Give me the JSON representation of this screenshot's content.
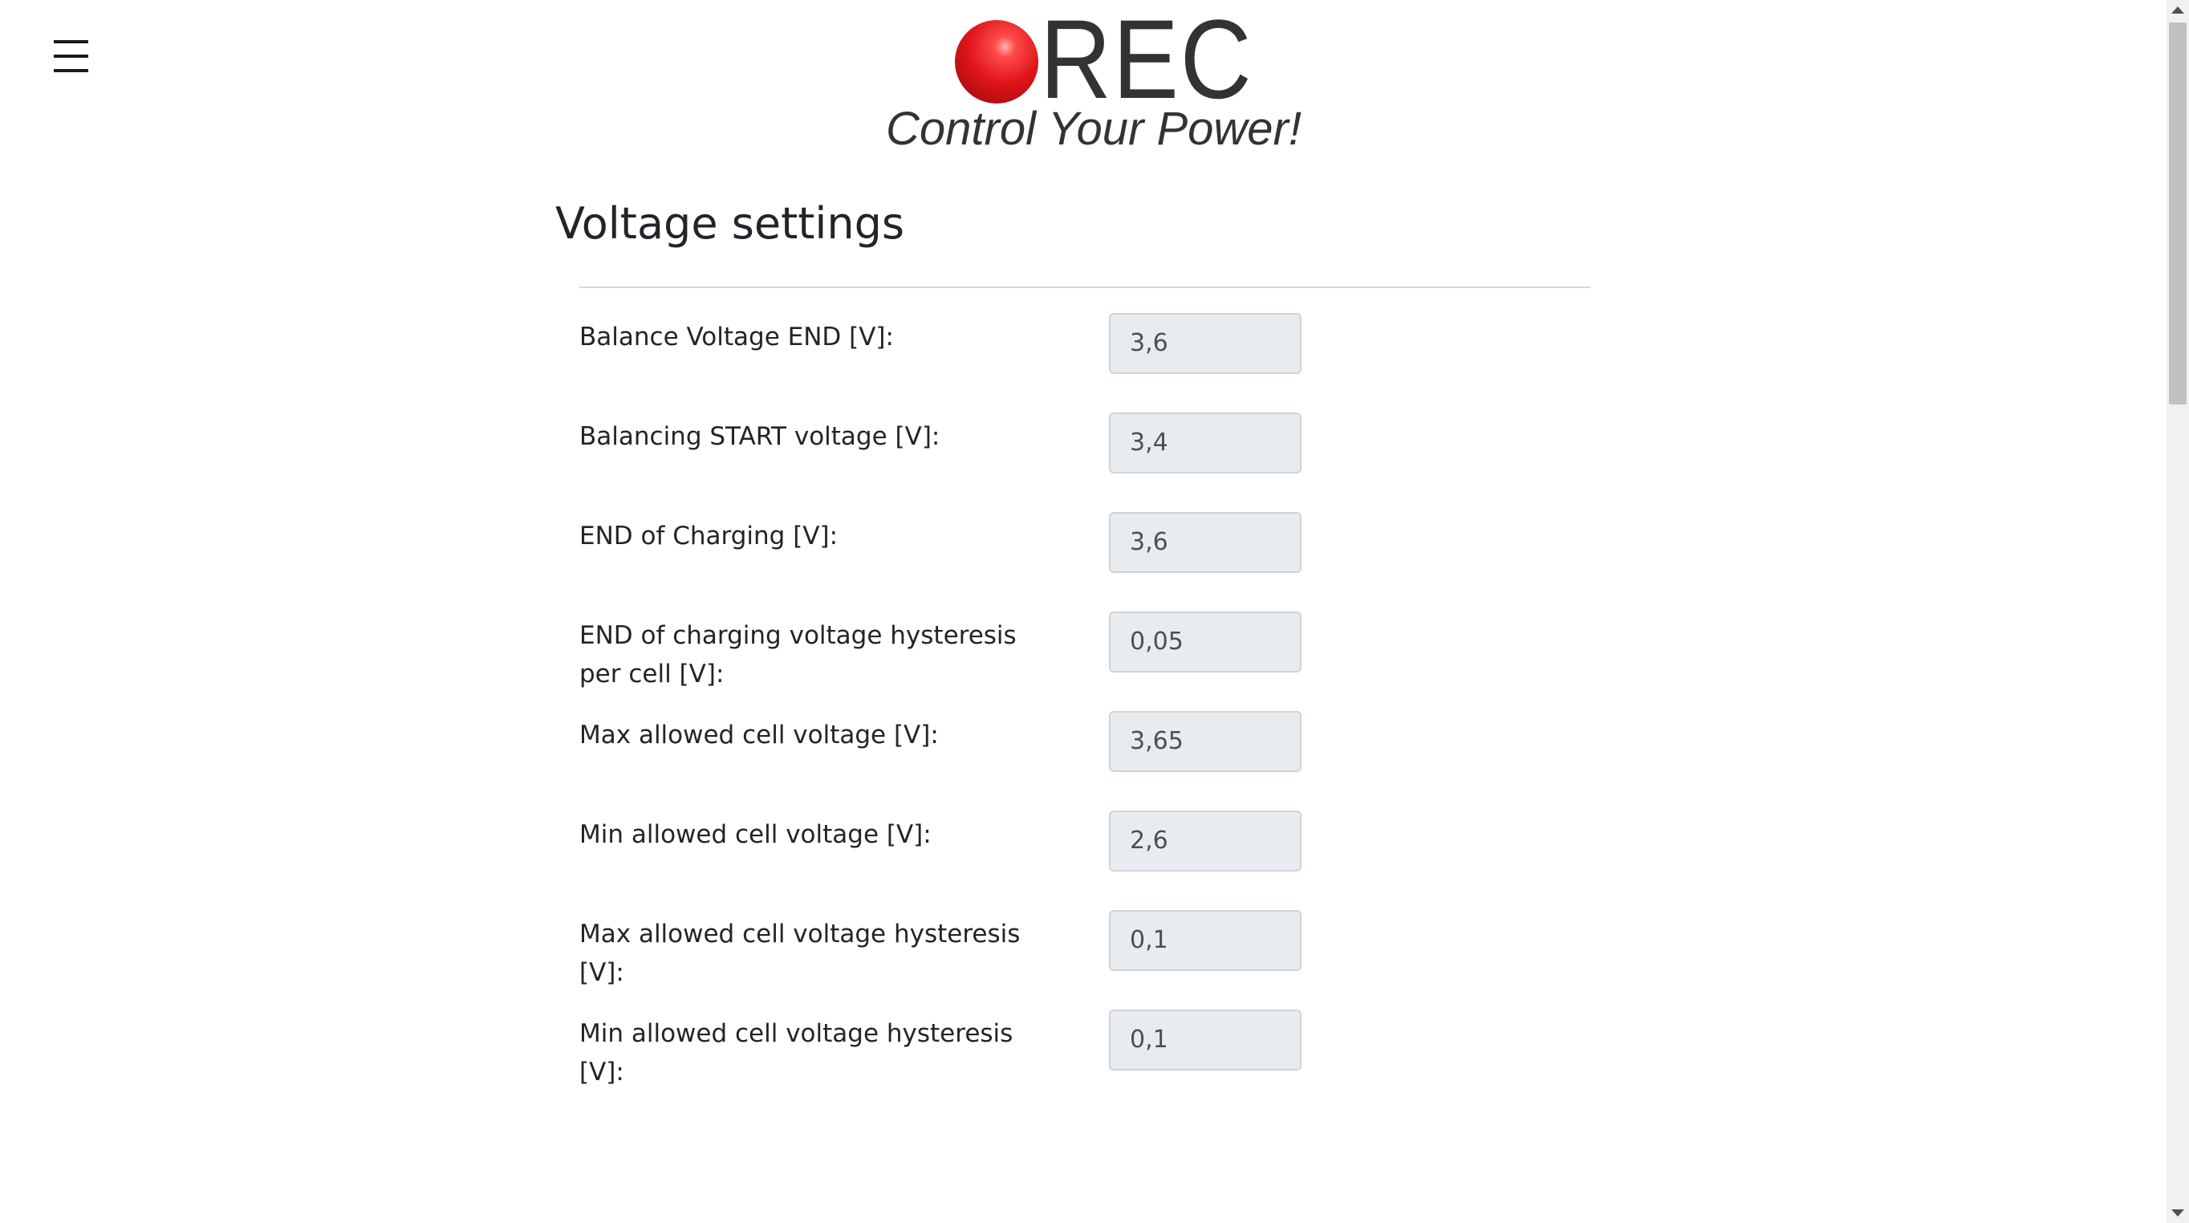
{
  "header": {
    "menu_icon": "hamburger-menu-icon",
    "logo": {
      "brand": "REC",
      "tagline": "Control Your Power!",
      "ball_color": "#e0151a"
    }
  },
  "main": {
    "title": "Voltage settings",
    "fields": [
      {
        "label": "Balance Voltage END [V]:",
        "value": "3,6"
      },
      {
        "label": "Balancing START voltage [V]:",
        "value": "3,4"
      },
      {
        "label": "END of Charging [V]:",
        "value": "3,6"
      },
      {
        "label": "END of charging voltage hysteresis per cell [V]:",
        "value": "0,05"
      },
      {
        "label": "Max allowed cell voltage [V]:",
        "value": "3,65"
      },
      {
        "label": "Min allowed cell voltage [V]:",
        "value": "2,6"
      },
      {
        "label": "Max allowed cell voltage hysteresis [V]:",
        "value": "0,1"
      },
      {
        "label": "Min allowed cell voltage hysteresis [V]:",
        "value": "0,1"
      }
    ]
  },
  "colors": {
    "input_background": "#e9ecef",
    "input_border": "#ced4da",
    "text": "#212529"
  }
}
